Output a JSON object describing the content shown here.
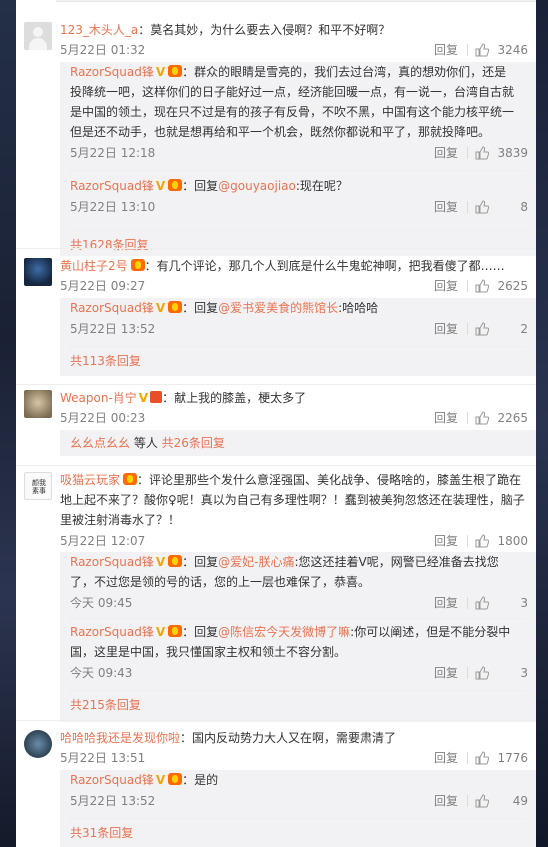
{
  "reply_label": "回复",
  "comments": [
    {
      "user": "123_木头人_a",
      "text": "：莫名其妙，为什么要去入侵啊？和平不好啊？",
      "time": "5月22日 01:32",
      "likes": "3246",
      "replies": [
        {
          "user": "RazorSquad锋",
          "text_line1": "：群众的眼睛是雪亮的，我们去过台湾，真的想劝你们，还是",
          "text_line2": "投降统一吧，这样你们的日子能好过一点，经济能回暖一点，有一说一，台湾自古就",
          "text_line3": "是中国的领土，现在只不过是有的孩子有反骨，不吹不黑，中国有这个能力核平统一",
          "text_line4": "但是还不动手，也就是想再给和平一个机会，既然你都说和平了，那就投降吧。",
          "time": "5月22日 12:18",
          "likes": "3839"
        },
        {
          "user": "RazorSquad锋",
          "prefix": "：回复",
          "mention": "@gouyaojiao",
          "text": ":现在呢？",
          "time": "5月22日 13:10",
          "likes": "8"
        }
      ],
      "more": "共1628条回复"
    },
    {
      "user": "黄山柱子2号",
      "text": "：有几个评论，那几个人到底是什么牛鬼蛇神啊，把我看傻了都……",
      "time": "5月22日 09:27",
      "likes": "2625",
      "replies": [
        {
          "user": "RazorSquad锋",
          "prefix": "：回复",
          "mention": "@爱书爱美食的熊馆长",
          "text": ":哈哈哈",
          "time": "5月22日 13:52",
          "likes": "2"
        }
      ],
      "more": "共113条回复"
    },
    {
      "user": "Weapon-肖宁",
      "text": "：献上我的膝盖，梗太多了",
      "time": "5月22日 00:23",
      "likes": "2265",
      "more_users": "幺幺点幺幺",
      "more_mid": " 等人 ",
      "more": "共26条回复"
    },
    {
      "user": "吸猫云玩家",
      "text_line1": "：评论里那些个发什么意淫强国、美化战争、侵略啥的，膝盖生根了跪在",
      "text_line2": "地上起不来了？酸你♀呢！真以为自己有多理性啊？！蠢到被美狗忽悠还在装理性，脑子",
      "text_line3": "里被注射消毒水了？！",
      "time": "5月22日 12:07",
      "likes": "1800",
      "avatar_text": "颜我素事",
      "replies": [
        {
          "user": "RazorSquad锋",
          "prefix": "：回复",
          "mention": "@爱妃-朕心痛",
          "text_line1": ":您这还挂着V呢，网警已经准备去找您",
          "text_line2": "了，不过您是领的号的话，您的上一层也难保了，恭喜。",
          "time": "今天 09:45",
          "likes": "3"
        },
        {
          "user": "RazorSquad锋",
          "prefix": "：回复",
          "mention": "@陈信宏今天发微博了嘛",
          "text_line1": ":你可以阐述，但是不能分裂中",
          "text_line2": "国，这里是中国，我只懂国家主权和领土不容分割。",
          "time": "今天 09:43",
          "likes": "3"
        }
      ],
      "more": "共215条回复"
    },
    {
      "user": "哈哈哈我还是发现你啦",
      "text": "：国内反动势力大人又在啊，需要肃清了",
      "time": "5月22日 13:51",
      "likes": "1776",
      "replies": [
        {
          "user": "RazorSquad锋",
          "text": "：是的",
          "time": "5月22日 13:52",
          "likes": "49"
        }
      ],
      "more": "共31条回复"
    }
  ],
  "colors": {
    "link": "#eb7350",
    "text": "#333333",
    "meta": "#808080",
    "reply_bg": "#f2f2f5",
    "verified": "#f7a400"
  },
  "icons": {
    "like": "thumbs-up-icon",
    "verified": "verified-v-icon",
    "fan_badge": "fan-badge-icon"
  }
}
